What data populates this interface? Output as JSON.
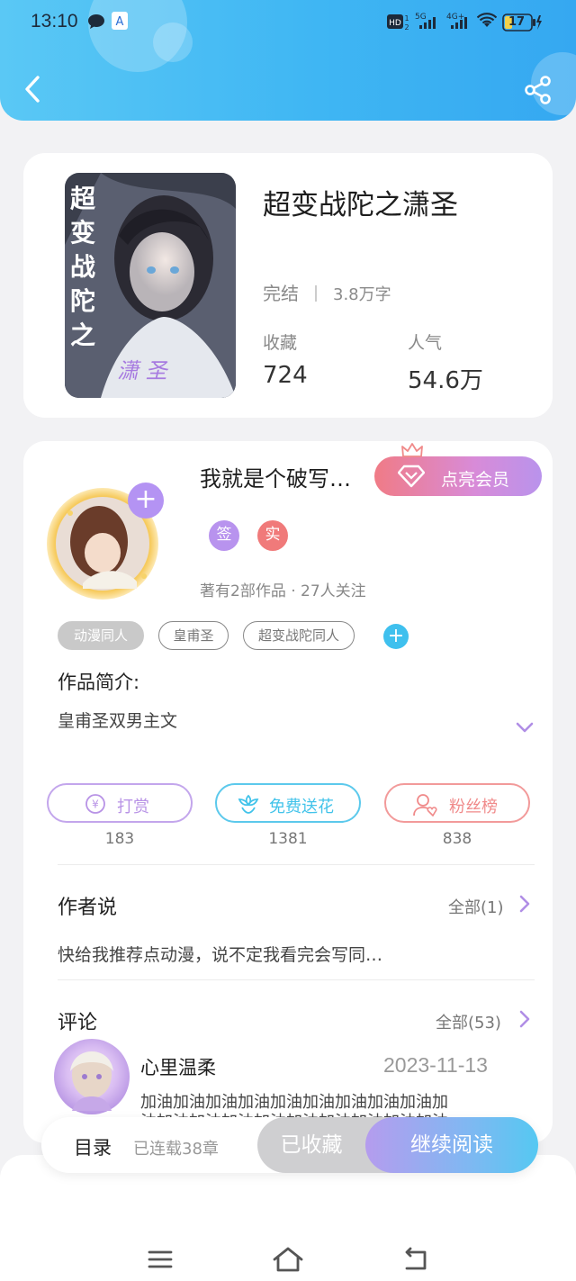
{
  "status_bar": {
    "time": "13:10",
    "network_5g": "5G",
    "network_4g": "4G+",
    "battery": "17"
  },
  "book": {
    "title": "超变战陀之潇圣",
    "status": "完结",
    "word_count": "3.8万字",
    "favorites_label": "收藏",
    "favorites_value": "724",
    "popularity_label": "人气",
    "popularity_value": "54.6万",
    "cover_text": "超变战陀之",
    "cover_text_small": "潇 圣"
  },
  "author": {
    "name": "我就是个破写…",
    "vip_button": "点亮会员",
    "badge_sign": "签",
    "badge_real": "实",
    "works_info": "著有2部作品 · 27人关注",
    "tags": [
      "动漫同人",
      "皇甫圣",
      "超变战陀同人"
    ],
    "intro_label": "作品简介:",
    "intro_text": "皇甫圣双男主文"
  },
  "actions": [
    {
      "label": "打赏",
      "count": "183",
      "color": "#b893e6"
    },
    {
      "label": "免费送花",
      "count": "1381",
      "color": "#42c3ea"
    },
    {
      "label": "粉丝榜",
      "count": "838",
      "color": "#f08a8a"
    }
  ],
  "author_says": {
    "label": "作者说",
    "all_link": "全部(1)",
    "text": "快给我推荐点动漫，说不定我看完会写同…"
  },
  "comments": {
    "label": "评论",
    "all_link": "全部(53)",
    "items": [
      {
        "user": "心里温柔",
        "date": "2023-11-13",
        "text": "加油加油加油加油加油加油加油加油加油加",
        "text2": "油加油加油加油加油加油加油加油加油加油"
      }
    ]
  },
  "bottom_bar": {
    "toc": "目录",
    "chapters": "已连载38章",
    "collected": "已收藏",
    "continue_reading": "继续阅读"
  },
  "colors": {
    "header_start": "#5ac8f5",
    "header_end": "#35a8f1",
    "accent_purple": "#b493f3"
  },
  "icons": [
    "back-icon",
    "share-icon",
    "diamond-icon",
    "crown-icon",
    "coin-icon",
    "flower-icon",
    "fans-icon",
    "chevron-right-icon",
    "chevron-down-icon",
    "menu-icon",
    "home-icon",
    "return-icon"
  ]
}
